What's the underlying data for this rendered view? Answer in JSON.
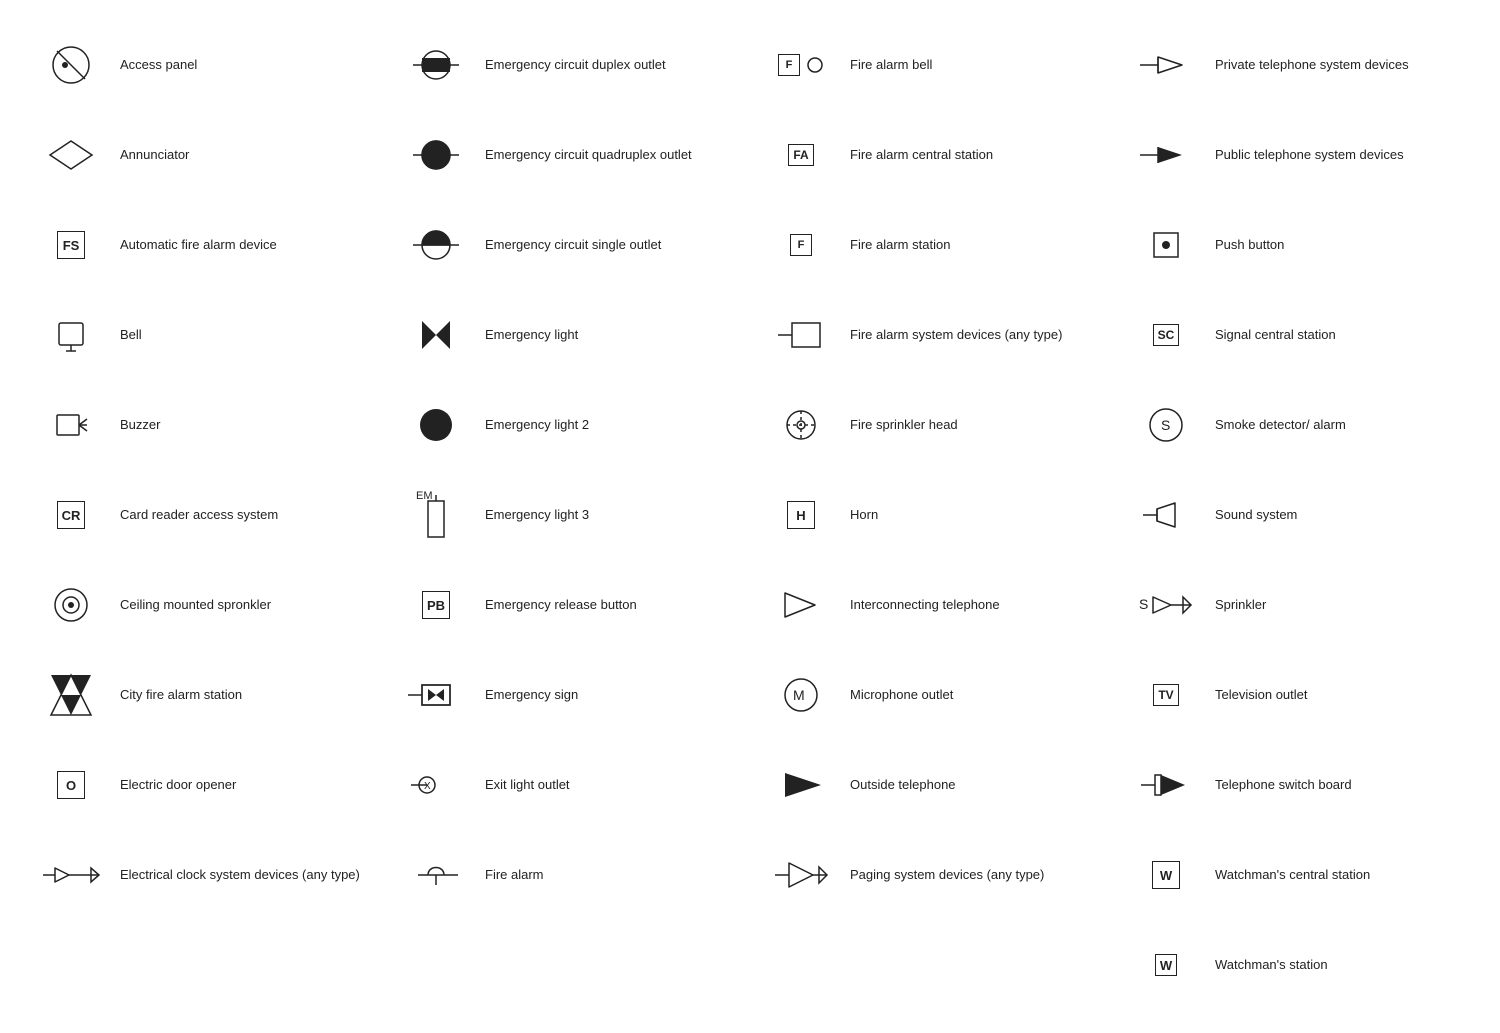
{
  "items": [
    {
      "id": "access-panel",
      "label": "Access panel",
      "symbolType": "circle-slash"
    },
    {
      "id": "annunciator",
      "label": "Annunciator",
      "symbolType": "diamond"
    },
    {
      "id": "auto-fire-alarm",
      "label": "Automatic fire alarm device",
      "symbolType": "box-text",
      "boxText": "FS"
    },
    {
      "id": "bell",
      "label": "Bell",
      "symbolType": "bell"
    },
    {
      "id": "buzzer",
      "label": "Buzzer",
      "symbolType": "buzzer"
    },
    {
      "id": "card-reader",
      "label": "Card reader access system",
      "symbolType": "box-text",
      "boxText": "CR"
    },
    {
      "id": "ceiling-sprinkler",
      "label": "Ceiling mounted spronkler",
      "symbolType": "ceiling-sprinkler"
    },
    {
      "id": "city-fire-alarm",
      "label": "City fire alarm station",
      "symbolType": "city-fire"
    },
    {
      "id": "electric-door",
      "label": "Electric door opener",
      "symbolType": "box-text",
      "boxText": "O"
    },
    {
      "id": "elec-clock",
      "label": "Electrical clock system devices (any type)",
      "symbolType": "elec-clock"
    },
    {
      "id": "emergency-duplex",
      "label": "Emergency circuit duplex outlet",
      "symbolType": "emerg-duplex"
    },
    {
      "id": "emergency-quadruplex",
      "label": "Emergency circuit quadruplex outlet",
      "symbolType": "emerg-quad"
    },
    {
      "id": "emergency-single",
      "label": "Emergency circuit single outlet",
      "symbolType": "emerg-single"
    },
    {
      "id": "emergency-light",
      "label": "Emergency light",
      "symbolType": "emerg-light"
    },
    {
      "id": "emergency-light2",
      "label": "Emergency light 2",
      "symbolType": "circle-filled"
    },
    {
      "id": "emergency-light3",
      "label": "Emergency light 3",
      "symbolType": "emerg-light3"
    },
    {
      "id": "emergency-release",
      "label": "Emergency release button",
      "symbolType": "box-text",
      "boxText": "PB"
    },
    {
      "id": "emergency-sign",
      "label": "Emergency sign",
      "symbolType": "emerg-sign"
    },
    {
      "id": "exit-light",
      "label": "Exit light outlet",
      "symbolType": "exit-light"
    },
    {
      "id": "fire-alarm-main",
      "label": "Fire alarm",
      "symbolType": "fire-alarm"
    },
    {
      "id": "fire-alarm-bell",
      "label": "Fire alarm bell",
      "symbolType": "fire-alarm-bell"
    },
    {
      "id": "fire-alarm-central",
      "label": "Fire alarm central station",
      "symbolType": "fire-alarm-central"
    },
    {
      "id": "fire-alarm-station",
      "label": "Fire alarm station",
      "symbolType": "fire-alarm-station"
    },
    {
      "id": "fire-alarm-system",
      "label": "Fire alarm system devices (any type)",
      "symbolType": "fire-alarm-system"
    },
    {
      "id": "fire-sprinkler",
      "label": "Fire sprinkler head",
      "symbolType": "fire-sprinkler"
    },
    {
      "id": "horn",
      "label": "Horn",
      "symbolType": "box-text",
      "boxText": "H"
    },
    {
      "id": "interconnecting",
      "label": "Interconnecting telephone",
      "symbolType": "intercon-phone"
    },
    {
      "id": "microphone",
      "label": "Microphone outlet",
      "symbolType": "circle-m"
    },
    {
      "id": "outside-phone",
      "label": "Outside telephone",
      "symbolType": "outside-phone"
    },
    {
      "id": "paging",
      "label": "Paging system devices (any type)",
      "symbolType": "paging"
    },
    {
      "id": "private-phone",
      "label": "Private telephone system devices",
      "symbolType": "private-phone"
    },
    {
      "id": "public-phone",
      "label": "Public telephone system devices",
      "symbolType": "public-phone"
    },
    {
      "id": "push-button",
      "label": "Push button",
      "symbolType": "push-button"
    },
    {
      "id": "signal-central",
      "label": "Signal central station",
      "symbolType": "box-text-sc",
      "boxText": "SC"
    },
    {
      "id": "smoke-detector",
      "label": "Smoke detector/ alarm",
      "symbolType": "circle-s"
    },
    {
      "id": "sound-system",
      "label": "Sound system",
      "symbolType": "sound-system"
    },
    {
      "id": "sprinkler",
      "label": "Sprinkler",
      "symbolType": "sprinkler"
    },
    {
      "id": "television",
      "label": "Television outlet",
      "symbolType": "box-text-tv",
      "boxText": "TV"
    },
    {
      "id": "tel-switchboard",
      "label": "Telephone switch board",
      "symbolType": "tel-switchboard"
    },
    {
      "id": "watchman-central",
      "label": "Watchman's central station",
      "symbolType": "watchman-central"
    },
    {
      "id": "watchman-station",
      "label": "Watchman's station",
      "symbolType": "watchman-station"
    }
  ]
}
